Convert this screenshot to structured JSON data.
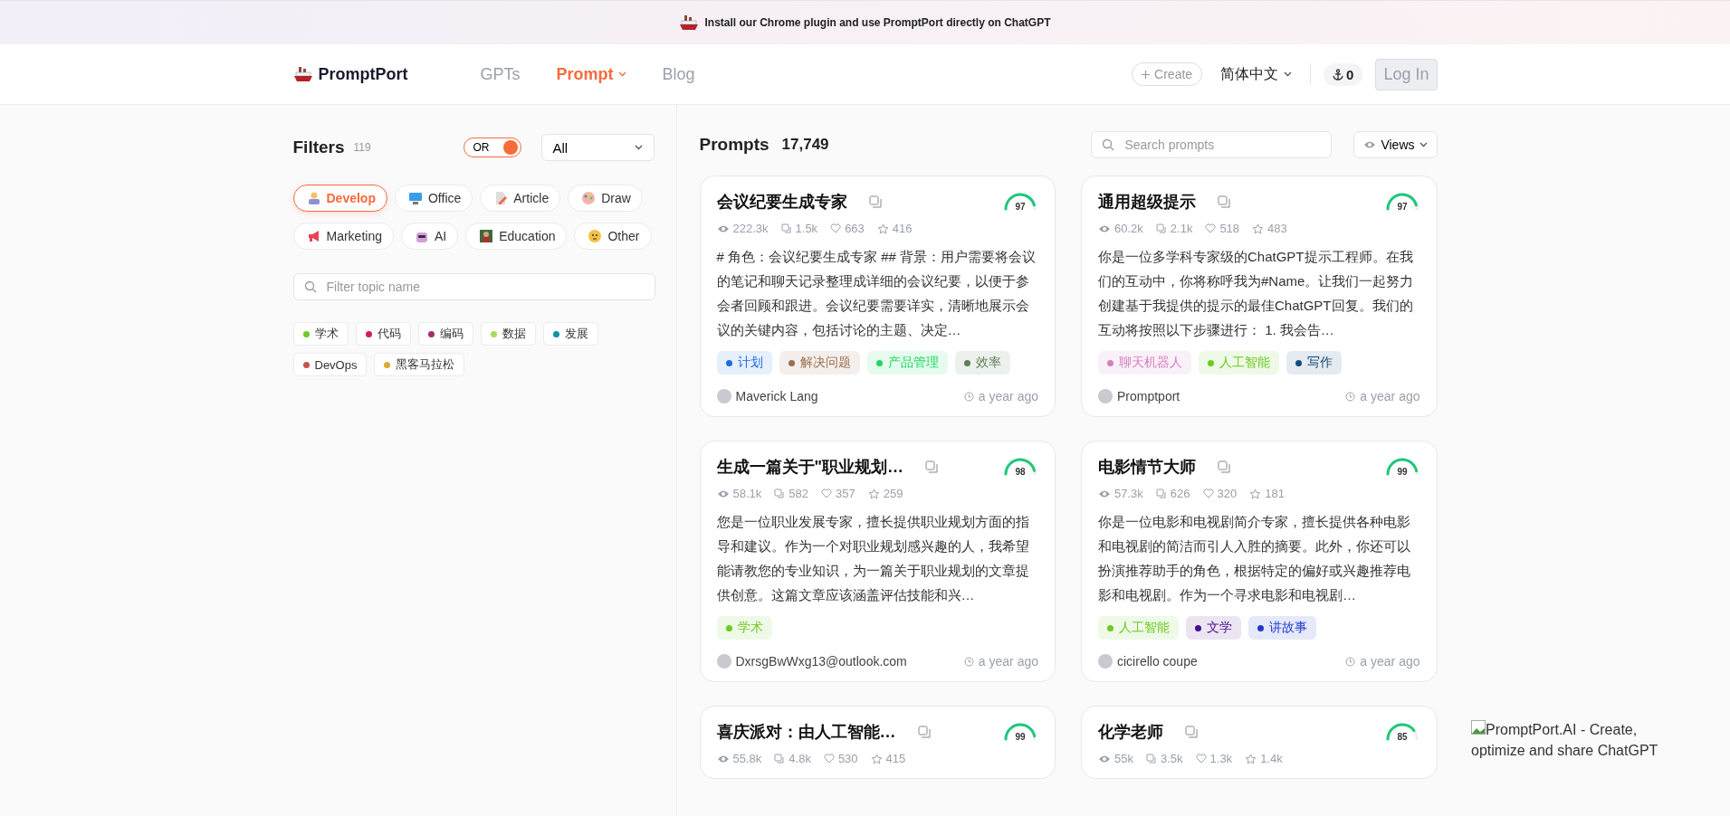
{
  "banner": {
    "text": "Install our Chrome plugin and use PromptPort directly on ChatGPT"
  },
  "nav": {
    "logo": "PromptPort",
    "links": [
      {
        "label": "GPTs",
        "selected": false,
        "dropdown": false
      },
      {
        "label": "Prompt",
        "selected": true,
        "dropdown": true
      },
      {
        "label": "Blog",
        "selected": false,
        "dropdown": false
      }
    ],
    "create": "Create",
    "language": "简体中文",
    "credits": "0",
    "login": "Log In"
  },
  "filters": {
    "title": "Filters",
    "count": "119",
    "toggle": {
      "label": "OR",
      "on": true
    },
    "select": "All",
    "categories": [
      {
        "label": "Develop",
        "selected": true
      },
      {
        "label": "Office",
        "selected": false
      },
      {
        "label": "Article",
        "selected": false
      },
      {
        "label": "Draw",
        "selected": false
      },
      {
        "label": "Marketing",
        "selected": false
      },
      {
        "label": "AI",
        "selected": false
      },
      {
        "label": "Education",
        "selected": false
      },
      {
        "label": "Other",
        "selected": false
      }
    ],
    "topic_search": {
      "placeholder": "Filter topic name"
    },
    "topics": [
      {
        "label": "学术",
        "color": "#6ecb23"
      },
      {
        "label": "代码",
        "color": "#d81b60"
      },
      {
        "label": "编码",
        "color": "#a0306f"
      },
      {
        "label": "数据",
        "color": "#a6dc5c"
      },
      {
        "label": "发展",
        "color": "#0e8fa8"
      },
      {
        "label": "DevOps",
        "color": "#c85050"
      },
      {
        "label": "黑客马拉松",
        "color": "#e0a830"
      }
    ]
  },
  "prompts": {
    "title": "Prompts",
    "count": "17,749",
    "search": {
      "placeholder": "Search prompts"
    },
    "views": "Views",
    "cards": [
      {
        "title": "会议纪要生成专家",
        "score": "97",
        "level": 0.97,
        "views": "222.3k",
        "copies": "1.5k",
        "likes": "663",
        "favorites": "416",
        "description": "# 角色：会议纪要生成专家 ## 背景：用户需要将会议的笔记和聊天记录整理成详细的会议纪要，以便于参会者回顾和跟进。会议纪要需要详实，清晰地展示会议的关键内容，包括讨论的主题、决定…",
        "tags": [
          {
            "label": "计划",
            "color": "#1d6ce0"
          },
          {
            "label": "解决问题",
            "color": "#9b6f4e"
          },
          {
            "label": "产品管理",
            "color": "#1ed760"
          },
          {
            "label": "效率",
            "color": "#5f7f5a"
          }
        ],
        "author": "Maverick Lang",
        "time": "a year ago"
      },
      {
        "title": "通用超级提示",
        "score": "97",
        "level": 0.97,
        "views": "60.2k",
        "copies": "2.1k",
        "likes": "518",
        "favorites": "483",
        "description": "你是一位多学科专家级的ChatGPT提示工程师。在我们的互动中，你将称呼我为#Name。让我们一起努力创建基于我提供的提示的最佳ChatGPT回复。我们的互动将按照以下步骤进行： 1. 我会告…",
        "tags": [
          {
            "label": "聊天机器人",
            "color": "#d57fbf"
          },
          {
            "label": "人工智能",
            "color": "#6ecb23"
          },
          {
            "label": "写作",
            "color": "#154a7a"
          }
        ],
        "author": "Promptport",
        "time": "a year ago"
      },
      {
        "title": "生成一篇关于\"职业规划…",
        "score": "98",
        "level": 0.98,
        "views": "58.1k",
        "copies": "582",
        "likes": "357",
        "favorites": "259",
        "description": "您是一位职业发展专家，擅长提供职业规划方面的指导和建议。作为一个对职业规划感兴趣的人，我希望能请教您的专业知识，为一篇关于职业规划的文章提供创意。这篇文章应该涵盖评估技能和兴…",
        "tags": [
          {
            "label": "学术",
            "color": "#6ecb23"
          }
        ],
        "author": "DxrsgBwWxg13@outlook.com",
        "time": "a year ago"
      },
      {
        "title": "电影情节大师",
        "score": "99",
        "level": 0.99,
        "views": "57.3k",
        "copies": "626",
        "likes": "320",
        "favorites": "181",
        "description": "你是一位电影和电视剧简介专家，擅长提供各种电影和电视剧的简洁而引人入胜的摘要。此外，你还可以扮演推荐助手的角色，根据特定的偏好或兴趣推荐电影和电视剧。作为一个寻求电影和电视剧…",
        "tags": [
          {
            "label": "人工智能",
            "color": "#6ecb23"
          },
          {
            "label": "文学",
            "color": "#4b0f8c"
          },
          {
            "label": "讲故事",
            "color": "#1d3acc"
          }
        ],
        "author": "cicirello coupe",
        "time": "a year ago"
      },
      {
        "title": "喜庆派对：由人工智能…",
        "score": "99",
        "level": 0.99,
        "views": "55.8k",
        "copies": "4.8k",
        "likes": "530",
        "favorites": "415"
      },
      {
        "title": "化学老师",
        "score": "85",
        "level": 0.85,
        "views": "55k",
        "copies": "3.5k",
        "likes": "1.3k",
        "favorites": "1.4k"
      }
    ]
  },
  "broken_image": {
    "alt": "PromptPort.AI - Create, optimize and share ChatGPT"
  }
}
